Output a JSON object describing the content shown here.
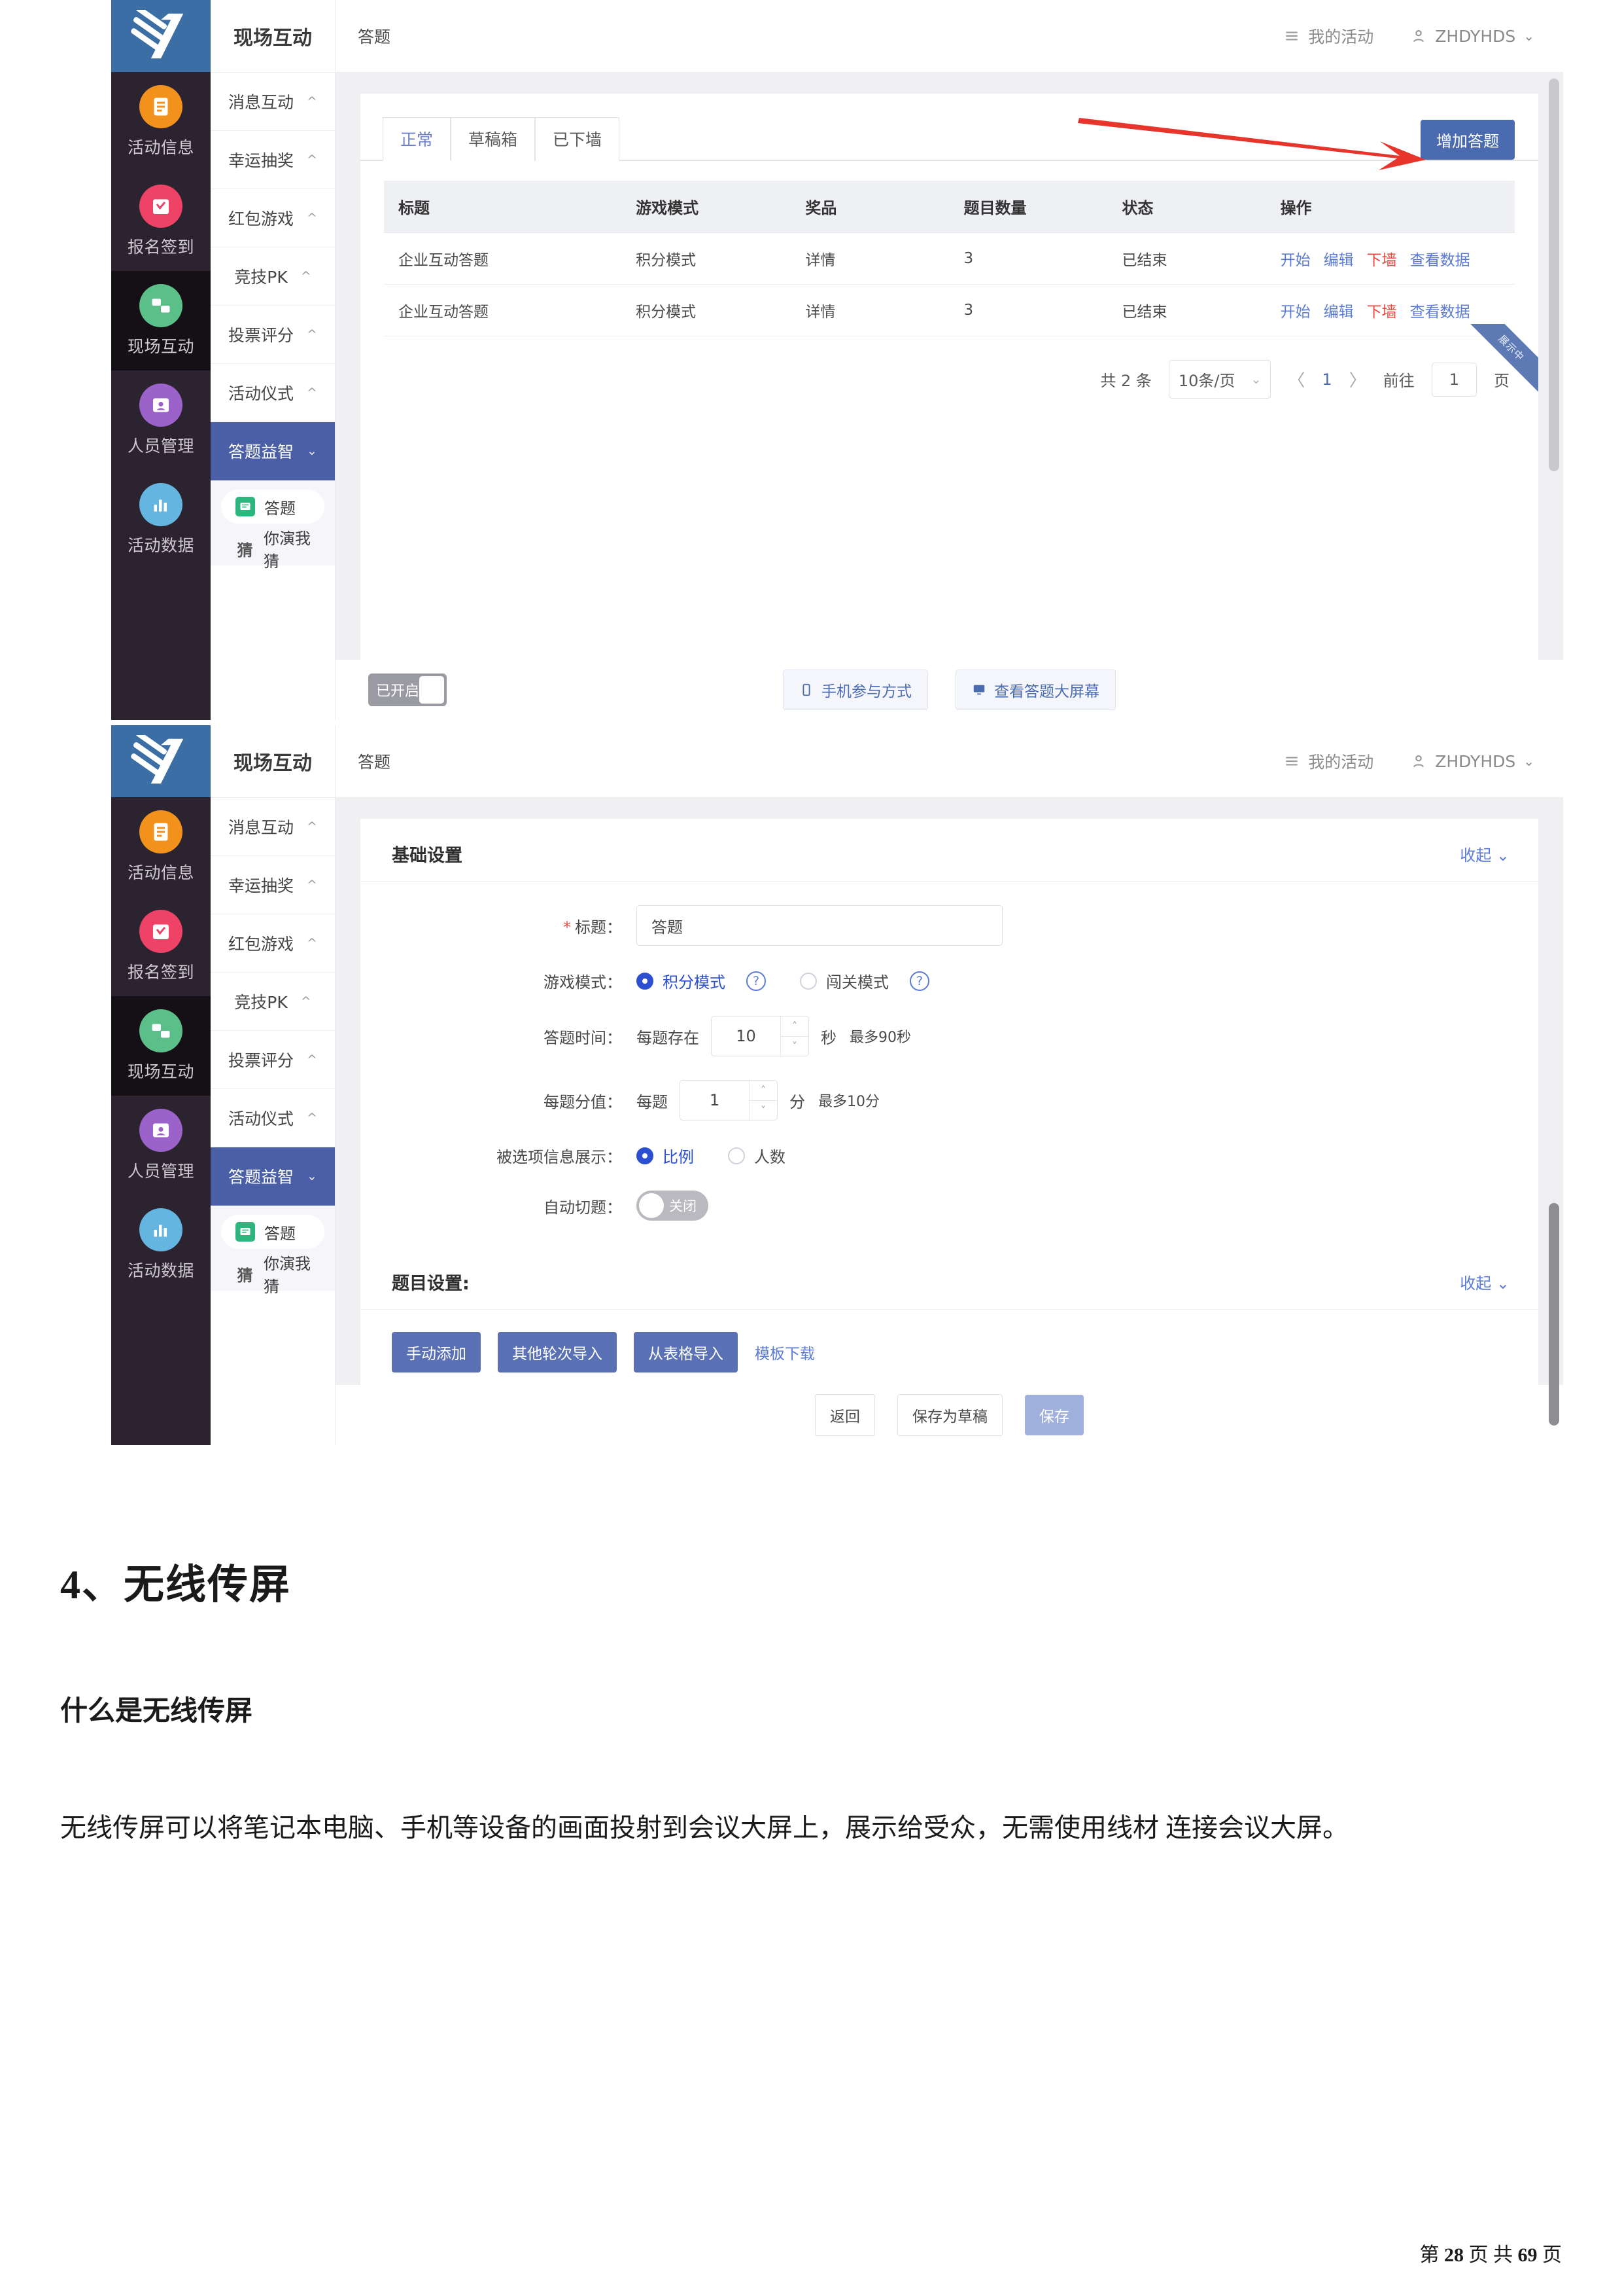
{
  "app": {
    "rail": {
      "logo_icon": "brand-logo-icon",
      "items": [
        {
          "label": "活动信息",
          "icon": "document-icon",
          "color": "#f2921d",
          "active": false
        },
        {
          "label": "报名签到",
          "icon": "calendar-check-icon",
          "color": "#ee4266",
          "active": false
        },
        {
          "label": "现场互动",
          "icon": "chat-exchange-icon",
          "color": "#5bbf8a",
          "active": true
        },
        {
          "label": "人员管理",
          "icon": "user-card-icon",
          "color": "#9b63c9",
          "active": false
        },
        {
          "label": "活动数据",
          "icon": "bar-chart-icon",
          "color": "#64b5e0",
          "active": false
        }
      ]
    },
    "menu": {
      "title": "现场互动",
      "items": [
        {
          "label": "消息互动",
          "chevron": "^",
          "selected": false
        },
        {
          "label": "幸运抽奖",
          "chevron": "^",
          "selected": false
        },
        {
          "label": "红包游戏",
          "chevron": "^",
          "selected": false
        },
        {
          "label": "竞技PK",
          "chevron": "^",
          "selected": false
        },
        {
          "label": "投票评分",
          "chevron": "^",
          "selected": false
        },
        {
          "label": "活动仪式",
          "chevron": "^",
          "selected": false
        },
        {
          "label": "答题益智",
          "chevron": "v",
          "selected": true
        }
      ],
      "submenu": [
        {
          "label": "答题",
          "icon": "quiz-icon",
          "active": true
        },
        {
          "label": "你演我猜",
          "glyph": "猜",
          "active": false
        }
      ]
    },
    "topbar": {
      "page_title": "答题",
      "my_activity": "我的活动",
      "my_activity_icon": "list-icon",
      "user_name": "ZHDYHDS",
      "user_icon": "person-icon",
      "user_chevron": "chevron-down-icon"
    },
    "list_view": {
      "tabs": [
        {
          "label": "正常",
          "active": true
        },
        {
          "label": "草稿箱",
          "active": false
        },
        {
          "label": "已下墙",
          "active": false
        }
      ],
      "add_button": "增加答题",
      "annotation_icon": "red-arrow-icon",
      "table": {
        "headers": [
          "标题",
          "游戏模式",
          "奖品",
          "题目数量",
          "状态",
          "操作"
        ],
        "rows": [
          {
            "title": "企业互动答题",
            "mode": "积分模式",
            "prize": "详情",
            "count": "3",
            "status": "已结束",
            "ops": [
              "开始",
              "编辑",
              "下墙",
              "查看数据"
            ]
          },
          {
            "title": "企业互动答题",
            "mode": "积分模式",
            "prize": "详情",
            "count": "3",
            "status": "已结束",
            "ops": [
              "开始",
              "编辑",
              "下墙",
              "查看数据"
            ],
            "ribbon": "展示中"
          }
        ]
      },
      "pagination": {
        "total": "共 2 条",
        "page_size": "10条/页",
        "prev": "〈",
        "current": "1",
        "next": "〉",
        "goto_label": "前往",
        "goto_value": "1",
        "goto_unit": "页"
      },
      "footer_bar": {
        "switch_label": "已开启",
        "phone_button": "手机参与方式",
        "phone_icon": "phone-icon",
        "screen_button": "查看答题大屏幕",
        "screen_icon": "monitor-icon"
      }
    },
    "edit_view": {
      "basic": {
        "title": "基础设置",
        "fold": "收起",
        "fold_icon": "chevron-down-icon",
        "fields": {
          "title_label": "标题：",
          "title_required": "*",
          "title_value": "答题",
          "mode_label": "游戏模式：",
          "mode_options": [
            {
              "label": "积分模式",
              "selected": true,
              "help_icon": "question-icon"
            },
            {
              "label": "闯关模式",
              "selected": false,
              "help_icon": "question-icon"
            }
          ],
          "time_label": "答题时间：",
          "time_prefix": "每题存在",
          "time_value": "10",
          "time_unit": "秒",
          "time_hint": "最多90秒",
          "score_label": "每题分值：",
          "score_prefix": "每题",
          "score_value": "1",
          "score_unit": "分",
          "score_hint": "最多10分",
          "display_label": "被选项信息展示：",
          "display_options": [
            {
              "label": "比例",
              "selected": true
            },
            {
              "label": "人数",
              "selected": false
            }
          ],
          "auto_label": "自动切题：",
          "auto_state": "关闭"
        }
      },
      "question": {
        "title": "题目设置:",
        "fold": "收起",
        "fold_icon": "chevron-down-icon",
        "buttons": [
          "手动添加",
          "其他轮次导入",
          "从表格导入"
        ],
        "template_link": "模板下载"
      },
      "save_bar": {
        "back": "返回",
        "draft": "保存为草稿",
        "save": "保存"
      }
    }
  },
  "document": {
    "heading": "4、无线传屏",
    "subheading": "什么是无线传屏",
    "paragraph": "无线传屏可以将笔记本电脑、手机等设备的画面投射到会议大屏上，展示给受众，无需使用线材 连接会议大屏。",
    "footer": {
      "prefix": "第",
      "page": "28",
      "mid1": "页",
      "mid2": "共",
      "total": "69",
      "suffix": "页"
    }
  },
  "colors": {
    "accent_blue": "#4a6bb0",
    "link_blue": "#5b7bd5",
    "danger_red": "#e8473f",
    "rail_dark": "#2b2430",
    "logo_blue": "#3b6ea5"
  }
}
